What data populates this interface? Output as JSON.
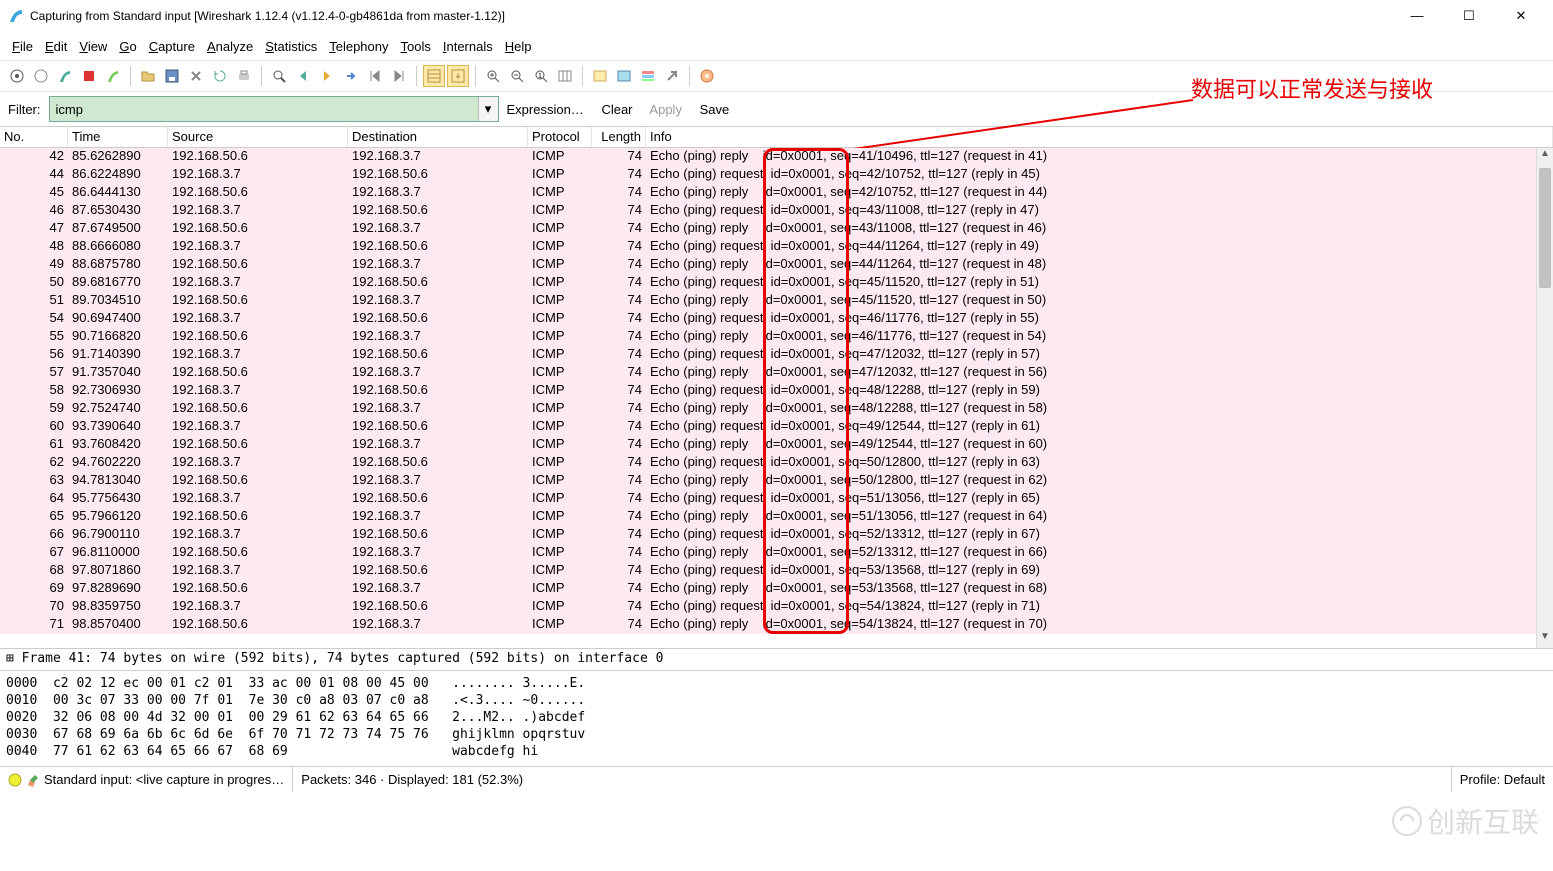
{
  "window": {
    "title": "Capturing from Standard input   [Wireshark 1.12.4  (v1.12.4-0-gb4861da from master-1.12)]"
  },
  "menu": [
    "File",
    "Edit",
    "View",
    "Go",
    "Capture",
    "Analyze",
    "Statistics",
    "Telephony",
    "Tools",
    "Internals",
    "Help"
  ],
  "filter": {
    "label": "Filter:",
    "value": "icmp",
    "links": {
      "expr": "Expression…",
      "clear": "Clear",
      "apply": "Apply",
      "save": "Save"
    }
  },
  "annotation": "数据可以正常发送与接收",
  "columns": {
    "no": "No.",
    "time": "Time",
    "src": "Source",
    "dst": "Destination",
    "proto": "Protocol",
    "len": "Length",
    "info": "Info"
  },
  "packets": [
    {
      "no": 42,
      "time": "85.6262890",
      "src": "192.168.50.6",
      "dst": "192.168.3.7",
      "proto": "ICMP",
      "len": 74,
      "kind": "reply",
      "tail": "id=0x0001, seq=41/10496, ttl=127 (request in 41)"
    },
    {
      "no": 44,
      "time": "86.6224890",
      "src": "192.168.3.7",
      "dst": "192.168.50.6",
      "proto": "ICMP",
      "len": 74,
      "kind": "request",
      "tail": "id=0x0001, seq=42/10752, ttl=127 (reply in 45)"
    },
    {
      "no": 45,
      "time": "86.6444130",
      "src": "192.168.50.6",
      "dst": "192.168.3.7",
      "proto": "ICMP",
      "len": 74,
      "kind": "reply",
      "tail": "id=0x0001, seq=42/10752, ttl=127 (request in 44)"
    },
    {
      "no": 46,
      "time": "87.6530430",
      "src": "192.168.3.7",
      "dst": "192.168.50.6",
      "proto": "ICMP",
      "len": 74,
      "kind": "request",
      "tail": "id=0x0001, seq=43/11008, ttl=127 (reply in 47)"
    },
    {
      "no": 47,
      "time": "87.6749500",
      "src": "192.168.50.6",
      "dst": "192.168.3.7",
      "proto": "ICMP",
      "len": 74,
      "kind": "reply",
      "tail": "id=0x0001, seq=43/11008, ttl=127 (request in 46)"
    },
    {
      "no": 48,
      "time": "88.6666080",
      "src": "192.168.3.7",
      "dst": "192.168.50.6",
      "proto": "ICMP",
      "len": 74,
      "kind": "request",
      "tail": "id=0x0001, seq=44/11264, ttl=127 (reply in 49)"
    },
    {
      "no": 49,
      "time": "88.6875780",
      "src": "192.168.50.6",
      "dst": "192.168.3.7",
      "proto": "ICMP",
      "len": 74,
      "kind": "reply",
      "tail": "id=0x0001, seq=44/11264, ttl=127 (request in 48)"
    },
    {
      "no": 50,
      "time": "89.6816770",
      "src": "192.168.3.7",
      "dst": "192.168.50.6",
      "proto": "ICMP",
      "len": 74,
      "kind": "request",
      "tail": "id=0x0001, seq=45/11520, ttl=127 (reply in 51)"
    },
    {
      "no": 51,
      "time": "89.7034510",
      "src": "192.168.50.6",
      "dst": "192.168.3.7",
      "proto": "ICMP",
      "len": 74,
      "kind": "reply",
      "tail": "id=0x0001, seq=45/11520, ttl=127 (request in 50)"
    },
    {
      "no": 54,
      "time": "90.6947400",
      "src": "192.168.3.7",
      "dst": "192.168.50.6",
      "proto": "ICMP",
      "len": 74,
      "kind": "request",
      "tail": "id=0x0001, seq=46/11776, ttl=127 (reply in 55)"
    },
    {
      "no": 55,
      "time": "90.7166820",
      "src": "192.168.50.6",
      "dst": "192.168.3.7",
      "proto": "ICMP",
      "len": 74,
      "kind": "reply",
      "tail": "id=0x0001, seq=46/11776, ttl=127 (request in 54)"
    },
    {
      "no": 56,
      "time": "91.7140390",
      "src": "192.168.3.7",
      "dst": "192.168.50.6",
      "proto": "ICMP",
      "len": 74,
      "kind": "request",
      "tail": "id=0x0001, seq=47/12032, ttl=127 (reply in 57)"
    },
    {
      "no": 57,
      "time": "91.7357040",
      "src": "192.168.50.6",
      "dst": "192.168.3.7",
      "proto": "ICMP",
      "len": 74,
      "kind": "reply",
      "tail": "id=0x0001, seq=47/12032, ttl=127 (request in 56)"
    },
    {
      "no": 58,
      "time": "92.7306930",
      "src": "192.168.3.7",
      "dst": "192.168.50.6",
      "proto": "ICMP",
      "len": 74,
      "kind": "request",
      "tail": "id=0x0001, seq=48/12288, ttl=127 (reply in 59)"
    },
    {
      "no": 59,
      "time": "92.7524740",
      "src": "192.168.50.6",
      "dst": "192.168.3.7",
      "proto": "ICMP",
      "len": 74,
      "kind": "reply",
      "tail": "id=0x0001, seq=48/12288, ttl=127 (request in 58)"
    },
    {
      "no": 60,
      "time": "93.7390640",
      "src": "192.168.3.7",
      "dst": "192.168.50.6",
      "proto": "ICMP",
      "len": 74,
      "kind": "request",
      "tail": "id=0x0001, seq=49/12544, ttl=127 (reply in 61)"
    },
    {
      "no": 61,
      "time": "93.7608420",
      "src": "192.168.50.6",
      "dst": "192.168.3.7",
      "proto": "ICMP",
      "len": 74,
      "kind": "reply",
      "tail": "id=0x0001, seq=49/12544, ttl=127 (request in 60)"
    },
    {
      "no": 62,
      "time": "94.7602220",
      "src": "192.168.3.7",
      "dst": "192.168.50.6",
      "proto": "ICMP",
      "len": 74,
      "kind": "request",
      "tail": "id=0x0001, seq=50/12800, ttl=127 (reply in 63)"
    },
    {
      "no": 63,
      "time": "94.7813040",
      "src": "192.168.50.6",
      "dst": "192.168.3.7",
      "proto": "ICMP",
      "len": 74,
      "kind": "reply",
      "tail": "id=0x0001, seq=50/12800, ttl=127 (request in 62)"
    },
    {
      "no": 64,
      "time": "95.7756430",
      "src": "192.168.3.7",
      "dst": "192.168.50.6",
      "proto": "ICMP",
      "len": 74,
      "kind": "request",
      "tail": "id=0x0001, seq=51/13056, ttl=127 (reply in 65)"
    },
    {
      "no": 65,
      "time": "95.7966120",
      "src": "192.168.50.6",
      "dst": "192.168.3.7",
      "proto": "ICMP",
      "len": 74,
      "kind": "reply",
      "tail": "id=0x0001, seq=51/13056, ttl=127 (request in 64)"
    },
    {
      "no": 66,
      "time": "96.7900110",
      "src": "192.168.3.7",
      "dst": "192.168.50.6",
      "proto": "ICMP",
      "len": 74,
      "kind": "request",
      "tail": "id=0x0001, seq=52/13312, ttl=127 (reply in 67)"
    },
    {
      "no": 67,
      "time": "96.8110000",
      "src": "192.168.50.6",
      "dst": "192.168.3.7",
      "proto": "ICMP",
      "len": 74,
      "kind": "reply",
      "tail": "id=0x0001, seq=52/13312, ttl=127 (request in 66)"
    },
    {
      "no": 68,
      "time": "97.8071860",
      "src": "192.168.3.7",
      "dst": "192.168.50.6",
      "proto": "ICMP",
      "len": 74,
      "kind": "request",
      "tail": "id=0x0001, seq=53/13568, ttl=127 (reply in 69)"
    },
    {
      "no": 69,
      "time": "97.8289690",
      "src": "192.168.50.6",
      "dst": "192.168.3.7",
      "proto": "ICMP",
      "len": 74,
      "kind": "reply",
      "tail": "id=0x0001, seq=53/13568, ttl=127 (request in 68)"
    },
    {
      "no": 70,
      "time": "98.8359750",
      "src": "192.168.3.7",
      "dst": "192.168.50.6",
      "proto": "ICMP",
      "len": 74,
      "kind": "request",
      "tail": "id=0x0001, seq=54/13824, ttl=127 (reply in 71)"
    },
    {
      "no": 71,
      "time": "98.8570400",
      "src": "192.168.50.6",
      "dst": "192.168.3.7",
      "proto": "ICMP",
      "len": 74,
      "kind": "reply",
      "tail": "id=0x0001, seq=54/13824, ttl=127 (request in 70)"
    }
  ],
  "tree": "⊞ Frame 41: 74 bytes on wire (592 bits), 74 bytes captured (592 bits) on interface 0",
  "hex": [
    "0000  c2 02 12 ec 00 01 c2 01  33 ac 00 01 08 00 45 00   ........ 3.....E.",
    "0010  00 3c 07 33 00 00 7f 01  7e 30 c0 a8 03 07 c0 a8   .<.3.... ~0......",
    "0020  32 06 08 00 4d 32 00 01  00 29 61 62 63 64 65 66   2...M2.. .)abcdef",
    "0030  67 68 69 6a 6b 6c 6d 6e  6f 70 71 72 73 74 75 76   ghijklmn opqrstuv",
    "0040  77 61 62 63 64 65 66 67  68 69                     wabcdefg hi"
  ],
  "status": {
    "left": "Standard input: <live capture in progres…",
    "mid": "Packets: 346 · Displayed: 181 (52.3%)",
    "right": "Profile: Default"
  },
  "watermark": "创新互联"
}
